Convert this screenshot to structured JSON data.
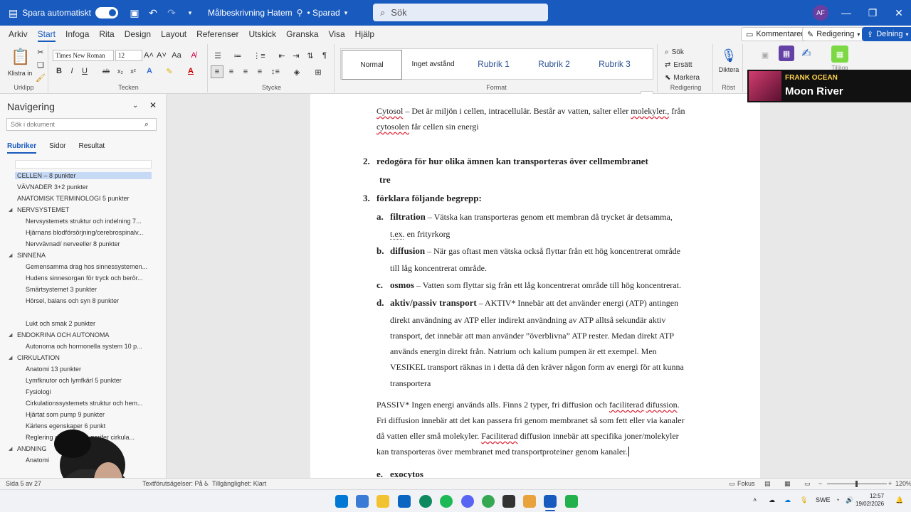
{
  "titlebar": {
    "autosave_label": "Spara automatiskt",
    "doc_title": "Målbeskrivning Hatem",
    "saved_state": "• Sparad",
    "search_placeholder": "Sök",
    "avatar_initials": "AF"
  },
  "menu": {
    "tabs": [
      "Arkiv",
      "Start",
      "Infoga",
      "Rita",
      "Design",
      "Layout",
      "Referenser",
      "Utskick",
      "Granska",
      "Visa",
      "Hjälp"
    ],
    "active_tab": "Start",
    "comments_label": "Kommentarer",
    "editing_label": "Redigering",
    "share_label": "Delning"
  },
  "ribbon": {
    "paste_label": "Klistra in",
    "clipboard_label": "Urklipp",
    "font_name": "Times New Roman",
    "font_size": "12",
    "font_group_label": "Tecken",
    "paragraph_group_label": "Stycke",
    "styles": [
      "Normal",
      "Inget avstånd",
      "Rubrik 1",
      "Rubrik 2",
      "Rubrik 3"
    ],
    "styles_group_label": "Format",
    "find_label": "Sök",
    "replace_label": "Ersätt",
    "select_label": "Markera",
    "editing_group_label": "Redigering",
    "dictate_label": "Diktera",
    "voice_group_label": "Röst",
    "addins_label": "Tillägg"
  },
  "nav": {
    "title": "Navigering",
    "search_placeholder": "Sök i dokument",
    "tabs": [
      "Rubriker",
      "Sidor",
      "Resultat"
    ],
    "active_tab": "Rubriker",
    "items": [
      {
        "label": "CELLEN – 8 punkter",
        "level": 1,
        "selected": true
      },
      {
        "label": "VÄVNADER 3+2 punkter",
        "level": 1
      },
      {
        "label": "ANATOMISK TERMINOLOGI 5 punkter",
        "level": 1
      },
      {
        "label": "NERVSYSTEMET",
        "level": 1,
        "expanded": true
      },
      {
        "label": "Nervsystemets struktur och indelning 7...",
        "level": 2
      },
      {
        "label": "Hjärnans blodförsörjning/cerebrospinalv...",
        "level": 2
      },
      {
        "label": "Nervvävnad/ nerveeller 8 punkter",
        "level": 2
      },
      {
        "label": "SINNENA",
        "level": 1,
        "expanded": true
      },
      {
        "label": "Gemensamma drag hos sinnessystemen...",
        "level": 2
      },
      {
        "label": "Hudens sinnesorgan för tryck och berör...",
        "level": 2
      },
      {
        "label": "Smärtsystemet 3 punkter",
        "level": 2
      },
      {
        "label": "Hörsel, balans och syn 8 punkter",
        "level": 2
      },
      {
        "label": "Lukt och smak 2 punkter",
        "level": 2
      },
      {
        "label": "ENDOKRINA OCH AUTONOMA",
        "level": 1,
        "expanded": true
      },
      {
        "label": "Autonoma och hormonella system 10 p...",
        "level": 2
      },
      {
        "label": "CIRKULATION",
        "level": 1,
        "expanded": true
      },
      {
        "label": "Anatomi 13 punkter",
        "level": 2
      },
      {
        "label": "Lymfknutor och lymfkärl 5 punkter",
        "level": 2
      },
      {
        "label": "Fysiologi",
        "level": 2
      },
      {
        "label": "Cirkulationssystemets struktur och hem...",
        "level": 2
      },
      {
        "label": "Hjärtat som pump 9 punkter",
        "level": 2
      },
      {
        "label": "Kärlens egenskaper 6 punkt",
        "level": 2
      },
      {
        "label": "Reglering av tryck och perifer cirkula...",
        "level": 2
      },
      {
        "label": "ANDNING",
        "level": 1,
        "expanded": true
      },
      {
        "label": "Anatomi",
        "level": 2
      }
    ]
  },
  "document": {
    "cytosol_term": "Cytosol",
    "cytosol_l1": " – Det är miljön i cellen, intracellulär. Består av vatten, salter eller ",
    "cytosol_l1_word": "molekyler.,",
    "cytosol_l1_end": " från",
    "cytosol_l2_word": "cytosolen",
    "cytosol_l2": " får cellen sin energi",
    "item2_num": "2.",
    "item2_text": "redogöra för hur olika ämnen kan transporteras över cellmembranet",
    "item2_sub": "tre",
    "item3_num": "3.",
    "item3_text": "förklara följande begrepp:",
    "a_letter": "a.",
    "a_term": "filtration",
    "a_l1": " – Vätska kan transporteras genom ett membran då trycket är detsamma,",
    "a_l2_word": "t.ex.",
    "a_l2": " en frityrkorg",
    "b_letter": "b.",
    "b_term": "diffusion",
    "b_l1": " – När gas oftast men vätska också flyttar från ett hög koncentrerat område",
    "b_l2": "till låg koncentrerat område.",
    "c_letter": "c.",
    "c_term": "osmos",
    "c_l1": " – Vatten som flyttar sig från ett låg koncentrerat område till hög koncentrerat.",
    "d_letter": "d.",
    "d_term": "aktiv/passiv transport",
    "d_l1": " – AKTIV* Innebär att det använder energi (ATP) antingen",
    "d_l2": "direkt användning av ATP eller indirekt användning av ATP alltså sekundär aktiv",
    "d_l3": "transport, det innebär att man använder ”överblivna” ATP rester. Medan direkt ATP",
    "d_l4": "används energin direkt från. Natrium och kalium pumpen är ett exempel. Men",
    "d_l5": "VESIKEL transport räknas in i detta då den kräver någon form av energi för att kunna",
    "d_l6": "transportera",
    "passiv_l1": "PASSIV* Ingen energi används alls. Finns 2 typer, fri diffusion och ",
    "passiv_l1_w1": "faciliterad",
    "passiv_l1_w2": "difussion",
    "passiv_l1_end": ".",
    "passiv_l2": "Fri diffusion innebär att det kan passera fri genom membranet så som fett eller via kanaler",
    "passiv_l3": "då vatten eller små molekyler. ",
    "passiv_l3_word": "Faciliterad",
    "passiv_l3_end": " diffusion innebär att specifika joner/molekyler",
    "passiv_l4": "kan transporteras över membranet med transportproteiner genom kanaler.",
    "e_letter": "e.",
    "e_term": "exocytos"
  },
  "overlay": {
    "artist": "FRANK OCEAN",
    "track": "Moon River"
  },
  "statusbar": {
    "page": "Sida 5 av 27",
    "text_predictions": "Textförutsägelser: På",
    "accessibility": "Tillgänglighet: Klart",
    "focus": "Fokus",
    "zoom": "120%"
  },
  "taskbar": {
    "lang": "SWE",
    "time": "12:57",
    "date": "19/02/2026"
  },
  "colors": {
    "accent": "#185abd",
    "spell_error": "#dd2233"
  }
}
